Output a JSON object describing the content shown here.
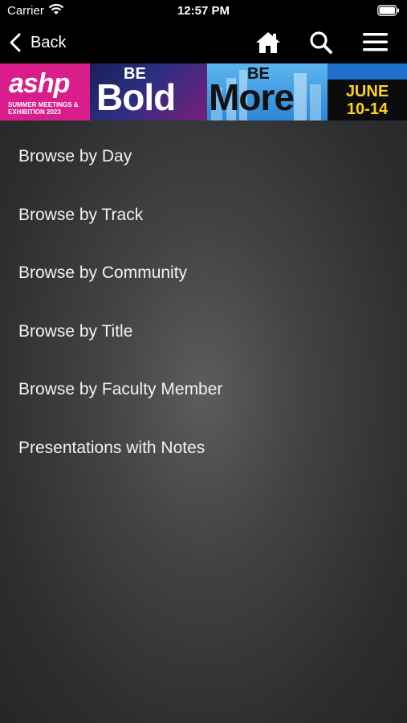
{
  "status_bar": {
    "carrier": "Carrier",
    "time": "12:57 PM"
  },
  "nav": {
    "back_label": "Back",
    "icons": [
      "home-icon",
      "search-icon",
      "menu-icon"
    ]
  },
  "banner": {
    "logo": "ashp",
    "subtitle": "SUMMER MEETINGS & EXHIBITION 2023",
    "be_1": "BE",
    "word_1": "Bold",
    "be_2": "BE",
    "word_2": "More",
    "date_line1": "JUNE",
    "date_line2": "10-14",
    "colors": {
      "pink": "#d91e8c",
      "yellow": "#ffd21a",
      "blue": "#2e86d6"
    }
  },
  "menu": {
    "items": [
      {
        "label": "Browse by Day"
      },
      {
        "label": "Browse by Track"
      },
      {
        "label": "Browse by Community"
      },
      {
        "label": "Browse by Title"
      },
      {
        "label": "Browse by Faculty Member"
      },
      {
        "label": "Presentations with Notes"
      }
    ]
  }
}
